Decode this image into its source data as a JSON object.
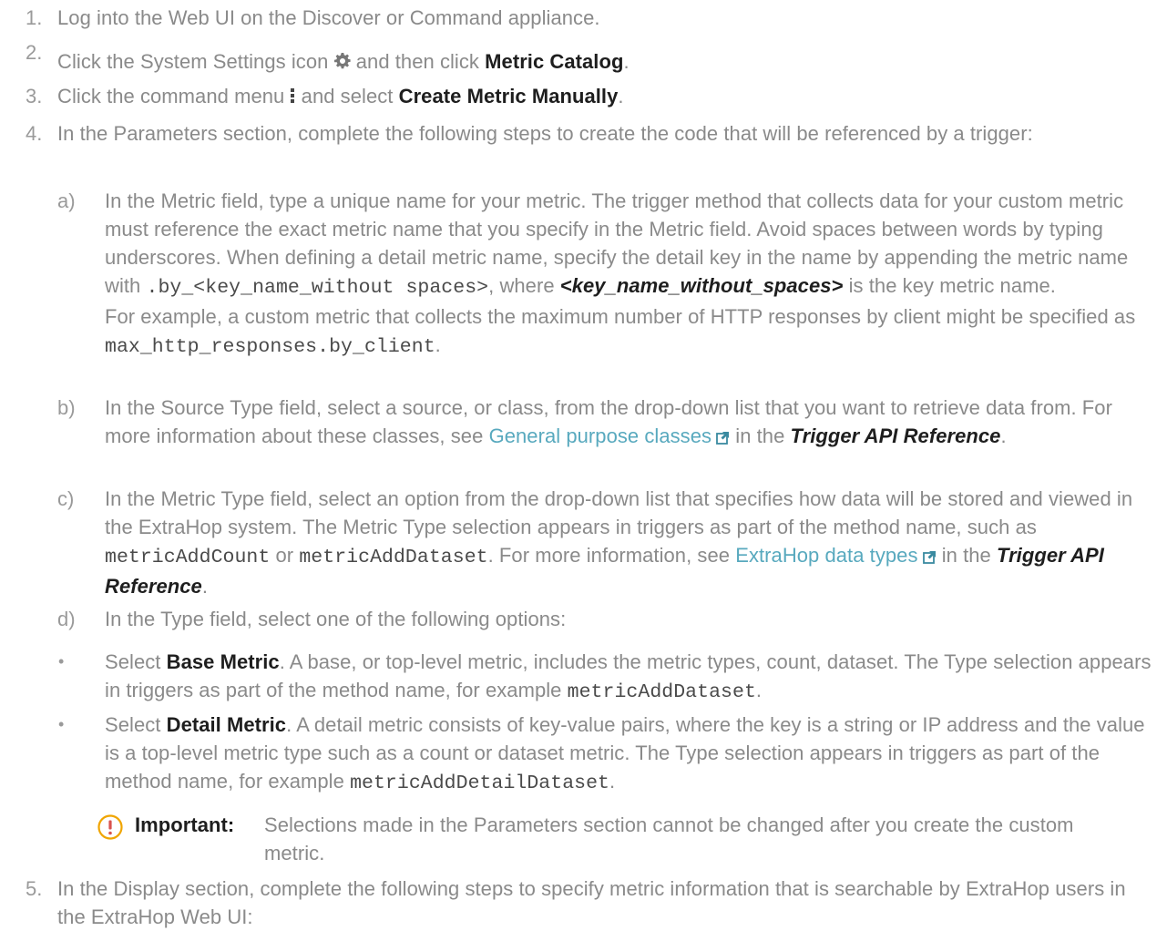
{
  "steps": {
    "s1": {
      "num": "1.",
      "text": "Log into the Web UI on the Discover or Command appliance."
    },
    "s2": {
      "num": "2.",
      "pre": "Click the System Settings icon",
      "mid": "and then click",
      "bold": "Metric Catalog",
      "end": "."
    },
    "s3": {
      "num": "3.",
      "pre": "Click the command menu",
      "mid": "and select",
      "bold": "Create Metric Manually",
      "end": "."
    },
    "s4": {
      "num": "4.",
      "text": "In the Parameters section, complete the following steps to create the code that will be referenced by a trigger:"
    },
    "s5": {
      "num": "5.",
      "text": "In the Display section, complete the following steps to specify metric information that is searchable by ExtraHop users in the ExtraHop Web UI:"
    }
  },
  "substeps": {
    "a": {
      "num": "a)",
      "p1": "In the Metric field, type a unique name for your metric. The trigger method that collects data for your custom metric must reference the exact metric name that you specify in the Metric field. Avoid spaces between words by typing underscores. When defining a detail metric name, specify the detail key in the name by appending the metric name with",
      "code1": ".by_<key_name_without spaces>",
      "p2": ", where",
      "bi": "<key_name_without_spaces>",
      "p3": "is the key metric name.",
      "ex1": "For example, a custom metric that collects the maximum number of HTTP responses by client might be specified as",
      "excode": "max_http_responses.by_client",
      "ex2": "."
    },
    "b": {
      "num": "b)",
      "p1": "In the Source Type field, select a source, or class, from the drop-down list that you want to retrieve data from. For more information about these classes, see",
      "link": "General purpose classes",
      "p2": "in the",
      "bi": "Trigger API Reference",
      "p3": "."
    },
    "c": {
      "num": "c)",
      "p1": "In the Metric Type field, select an option from the drop-down list that specifies how data will be stored and viewed in the ExtraHop system. The Metric Type selection appears in triggers as part of the method name, such as",
      "code1": "metricAddCount",
      "or": "or",
      "code2": "metricAddDataset",
      "p2": ". For more information, see",
      "link": "ExtraHop data types",
      "p3": "in the",
      "bi": "Trigger API Reference",
      "p4": "."
    },
    "d": {
      "num": "d)",
      "text": "In the Type field, select one of the following options:"
    }
  },
  "bullets": [
    {
      "bullet": "•",
      "pre": "Select",
      "bold": "Base Metric",
      "text": ". A base, or top-level metric, includes the metric types, count, dataset. The Type selection appears in triggers as part of the method name, for example",
      "code": "metricAddDataset",
      "end": "."
    },
    {
      "bullet": "•",
      "pre": "Select",
      "bold": "Detail Metric",
      "text": ". A detail metric consists of key-value pairs, where the key is a string or IP address and the value is a top-level metric type such as a count or dataset metric. The Type selection appears in triggers as part of the method name, for example",
      "code": "metricAddDetailDataset",
      "end": "."
    }
  ],
  "note": {
    "label": "Important:",
    "text": "Selections made in the Parameters section cannot be changed after you create the custom metric.",
    "icon": "exclamation-circle-icon",
    "icon_color": "#f0a500"
  },
  "icons": {
    "gear": "gear-icon",
    "kebab": "vertical-ellipsis-icon",
    "external": "external-link-icon"
  },
  "colors": {
    "text": "#8a8a8a",
    "bold": "#1e1e1e",
    "link": "#58a9be",
    "accent": "#f0a500"
  }
}
